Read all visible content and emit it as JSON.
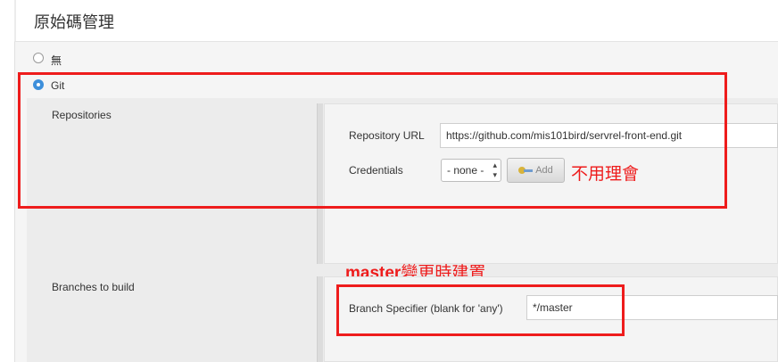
{
  "section": {
    "title": "原始碼管理"
  },
  "scm_options": [
    {
      "label": "無",
      "checked": false
    },
    {
      "label": "Git",
      "checked": true
    }
  ],
  "repositories": {
    "label": "Repositories",
    "url_label": "Repository URL",
    "url_value": "https://github.com/mis101bird/servrel-front-end.git",
    "credentials_label": "Credentials",
    "credentials_value": "- none -",
    "add_button_label": "Add"
  },
  "branches": {
    "label": "Branches to build",
    "specifier_label": "Branch Specifier (blank for 'any')",
    "specifier_value": "*/master"
  },
  "annotations": {
    "ignore_note": "不用理會",
    "master_note_bold": "master",
    "master_note_rest": "變更時建置",
    "color": "#ee1c1c"
  },
  "icons": {
    "select_arrows": "up-down-arrows-icon",
    "add_key": "key-icon"
  }
}
